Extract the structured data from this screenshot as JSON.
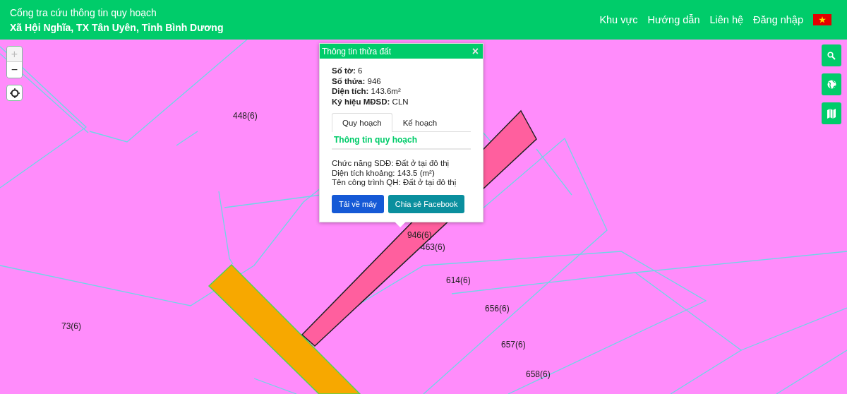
{
  "header": {
    "title": "Cổng tra cứu thông tin quy hoạch",
    "subtitle": "Xã Hội Nghĩa, TX Tân Uyên, Tỉnh Bình Dương",
    "nav": [
      "Khu vực",
      "Hướng dẫn",
      "Liên hệ",
      "Đăng nhập"
    ]
  },
  "map_controls": {
    "zoom_in": {
      "label": "+",
      "disabled": true
    },
    "zoom_out": {
      "label": "−",
      "disabled": false
    }
  },
  "parcel_labels": [
    "448(6)",
    "946(6)",
    "463(6)",
    "614(6)",
    "656(6)",
    "73(6)",
    "657(6)",
    "658(6)"
  ],
  "popup": {
    "title": "Thông tin thửa đất",
    "close": "×",
    "fields": [
      {
        "label": "Số tờ:",
        "value": "6"
      },
      {
        "label": "Số thửa:",
        "value": "946"
      },
      {
        "label": "Diện tích:",
        "value": "143.6m²"
      },
      {
        "label": "Ký hiệu MĐSD:",
        "value": "CLN"
      }
    ],
    "tabs": [
      {
        "label": "Quy hoạch",
        "selected": true
      },
      {
        "label": "Kế hoạch",
        "selected": false
      }
    ],
    "section_title": "Thông tin quy hoạch",
    "details": [
      "Chức năng SDĐ: Đất ở tại đô thị",
      "Diện tích khoảng: 143.5 (m²)",
      "Tên công trình QH: Đất ở tại đô thị"
    ],
    "buttons": [
      {
        "label": "Tải về máy",
        "kind": "primary"
      },
      {
        "label": "Chia sẻ Facebook",
        "kind": "share"
      }
    ]
  }
}
